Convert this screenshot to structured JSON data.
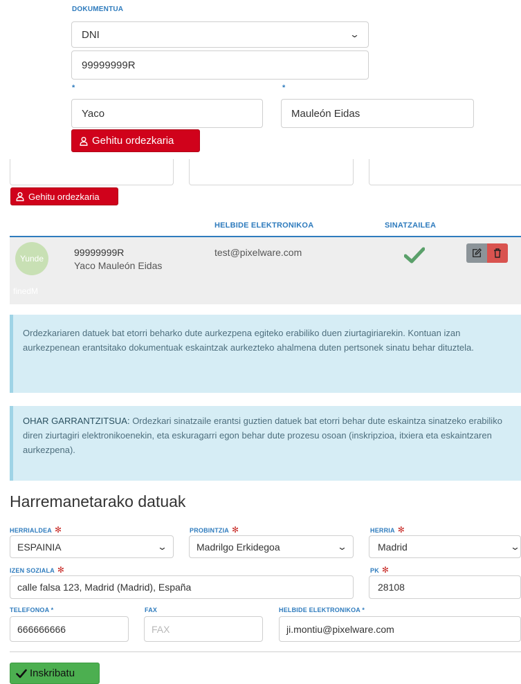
{
  "document": {
    "label": "DOKUMENTUA",
    "type_value": "DNI",
    "number_value": "99999999R",
    "first_name_label": "*",
    "last_name_label": "*",
    "first_name_value": "Yaco",
    "last_name_value": "Mauleón Eidas",
    "add_rep_label": "Gehitu ordezkaria"
  },
  "second_add_rep_label": "Gehitu ordezkaria",
  "reps_table": {
    "headers": {
      "email": "HELBIDE ELEKTRONIKOA",
      "signer": "SINATZAILEA"
    },
    "rows": [
      {
        "avatar_text": "Yunde",
        "avatar_subtext": "finedM",
        "id": "99999999R",
        "name": "Yaco Mauleón Eidas",
        "email": "test@pixelware.com"
      }
    ]
  },
  "alerts": {
    "info": "Ordezkariaren datuek bat etorri beharko dute aurkezpena egiteko erabiliko duen ziurtagiriarekin. Kontuan izan aurkezpenean erantsitako dokumentuak eskaintzak aurkezteko ahalmena duten pertsonek sinatu behar dituztela.",
    "important_lead": "OHAR GARRANTZITSUA:",
    "important_body": " Ordezkari sinatzaile erantsi guztien datuek bat etorri behar dute eskaintza sinatzeko erabiliko diren ziurtagiri elektronikoenekin, eta eskuragarri egon behar dute prozesu osoan (inskripzioa, itxiera eta eskaintzaren aurkezpena)."
  },
  "contact": {
    "title": "Harremanetarako datuak",
    "country_label": "HERRIALDEA",
    "country_value": "ESPAINIA",
    "province_label": "PROBINTZIA",
    "province_value": "Madrilgo Erkidegoa",
    "town_label": "HERRIA",
    "town_value": "Madrid",
    "address_label": "IZEN SOZIALA",
    "address_value": "calle falsa 123, Madrid (Madrid), España",
    "zip_label": "PK",
    "zip_value": "28108",
    "phone_label": "TELEFONOA *",
    "phone_value": "666666666",
    "fax_label": "FAX",
    "fax_placeholder": "FAX",
    "email_label": "HELBIDE ELEKTRONIKOA *",
    "email_value": "ji.montiu@pixelware.com"
  },
  "submit_label": "Inskribatu",
  "colors": {
    "accent_blue": "#2e7bbd",
    "danger_red": "#d0021b",
    "success_green": "#4caf50",
    "info_bg": "#d6edf5"
  }
}
